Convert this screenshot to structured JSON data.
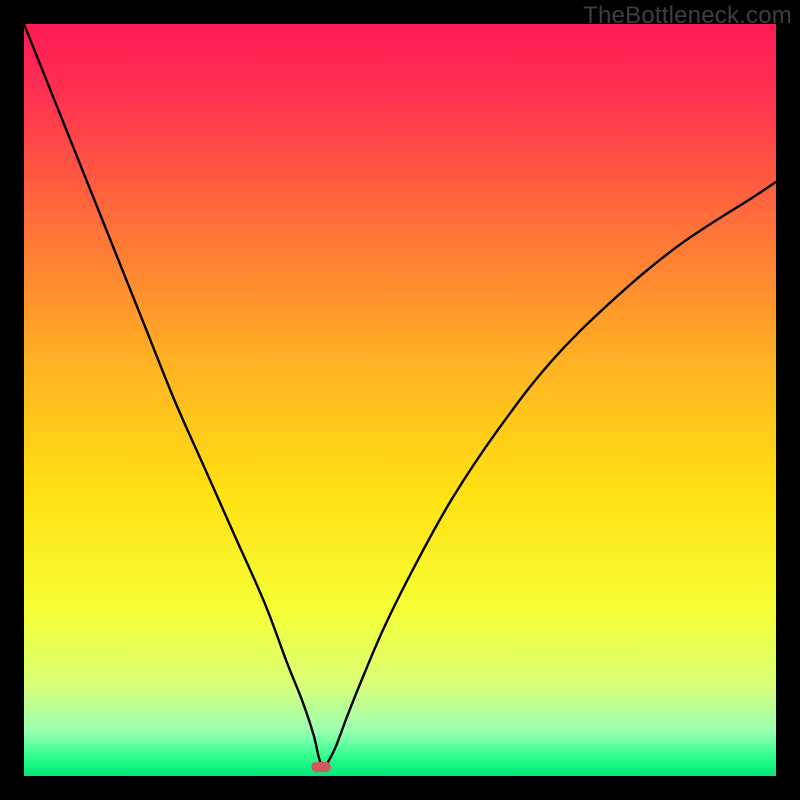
{
  "watermark": "TheBottleneck.com",
  "chart_data": {
    "type": "line",
    "title": "",
    "xlabel": "",
    "ylabel": "",
    "xlim": [
      0,
      100
    ],
    "ylim": [
      0,
      100
    ],
    "background": {
      "kind": "vertical-gradient",
      "stops": [
        {
          "pos": 0.0,
          "color": "#ff1a55"
        },
        {
          "pos": 0.1,
          "color": "#ff3350"
        },
        {
          "pos": 0.25,
          "color": "#ff6a3a"
        },
        {
          "pos": 0.45,
          "color": "#ffb223"
        },
        {
          "pos": 0.62,
          "color": "#ffe012"
        },
        {
          "pos": 0.78,
          "color": "#f5ff35"
        },
        {
          "pos": 0.88,
          "color": "#d8ff7a"
        },
        {
          "pos": 0.94,
          "color": "#9affb2"
        },
        {
          "pos": 0.975,
          "color": "#2dff8f"
        },
        {
          "pos": 1.0,
          "color": "#00e876"
        }
      ]
    },
    "series": [
      {
        "name": "bottleneck-curve",
        "x": [
          0,
          4,
          8,
          12,
          16,
          20,
          24,
          28,
          32,
          35,
          37,
          38.5,
          39.2,
          39.8,
          40.5,
          41.5,
          43,
          45,
          48,
          52,
          57,
          63,
          70,
          78,
          87,
          97,
          100
        ],
        "y": [
          100,
          90,
          80,
          70,
          60,
          50,
          41,
          32,
          23,
          15,
          10,
          5.5,
          2.5,
          1.0,
          2.0,
          4.0,
          8,
          13,
          20,
          28,
          37,
          46,
          55,
          63,
          70.5,
          77,
          79
        ]
      }
    ],
    "marker": {
      "name": "optimum-marker",
      "x": 39.5,
      "y": 1.2,
      "width": 2.6,
      "height": 1.4,
      "color": "#cf5a5a"
    }
  }
}
